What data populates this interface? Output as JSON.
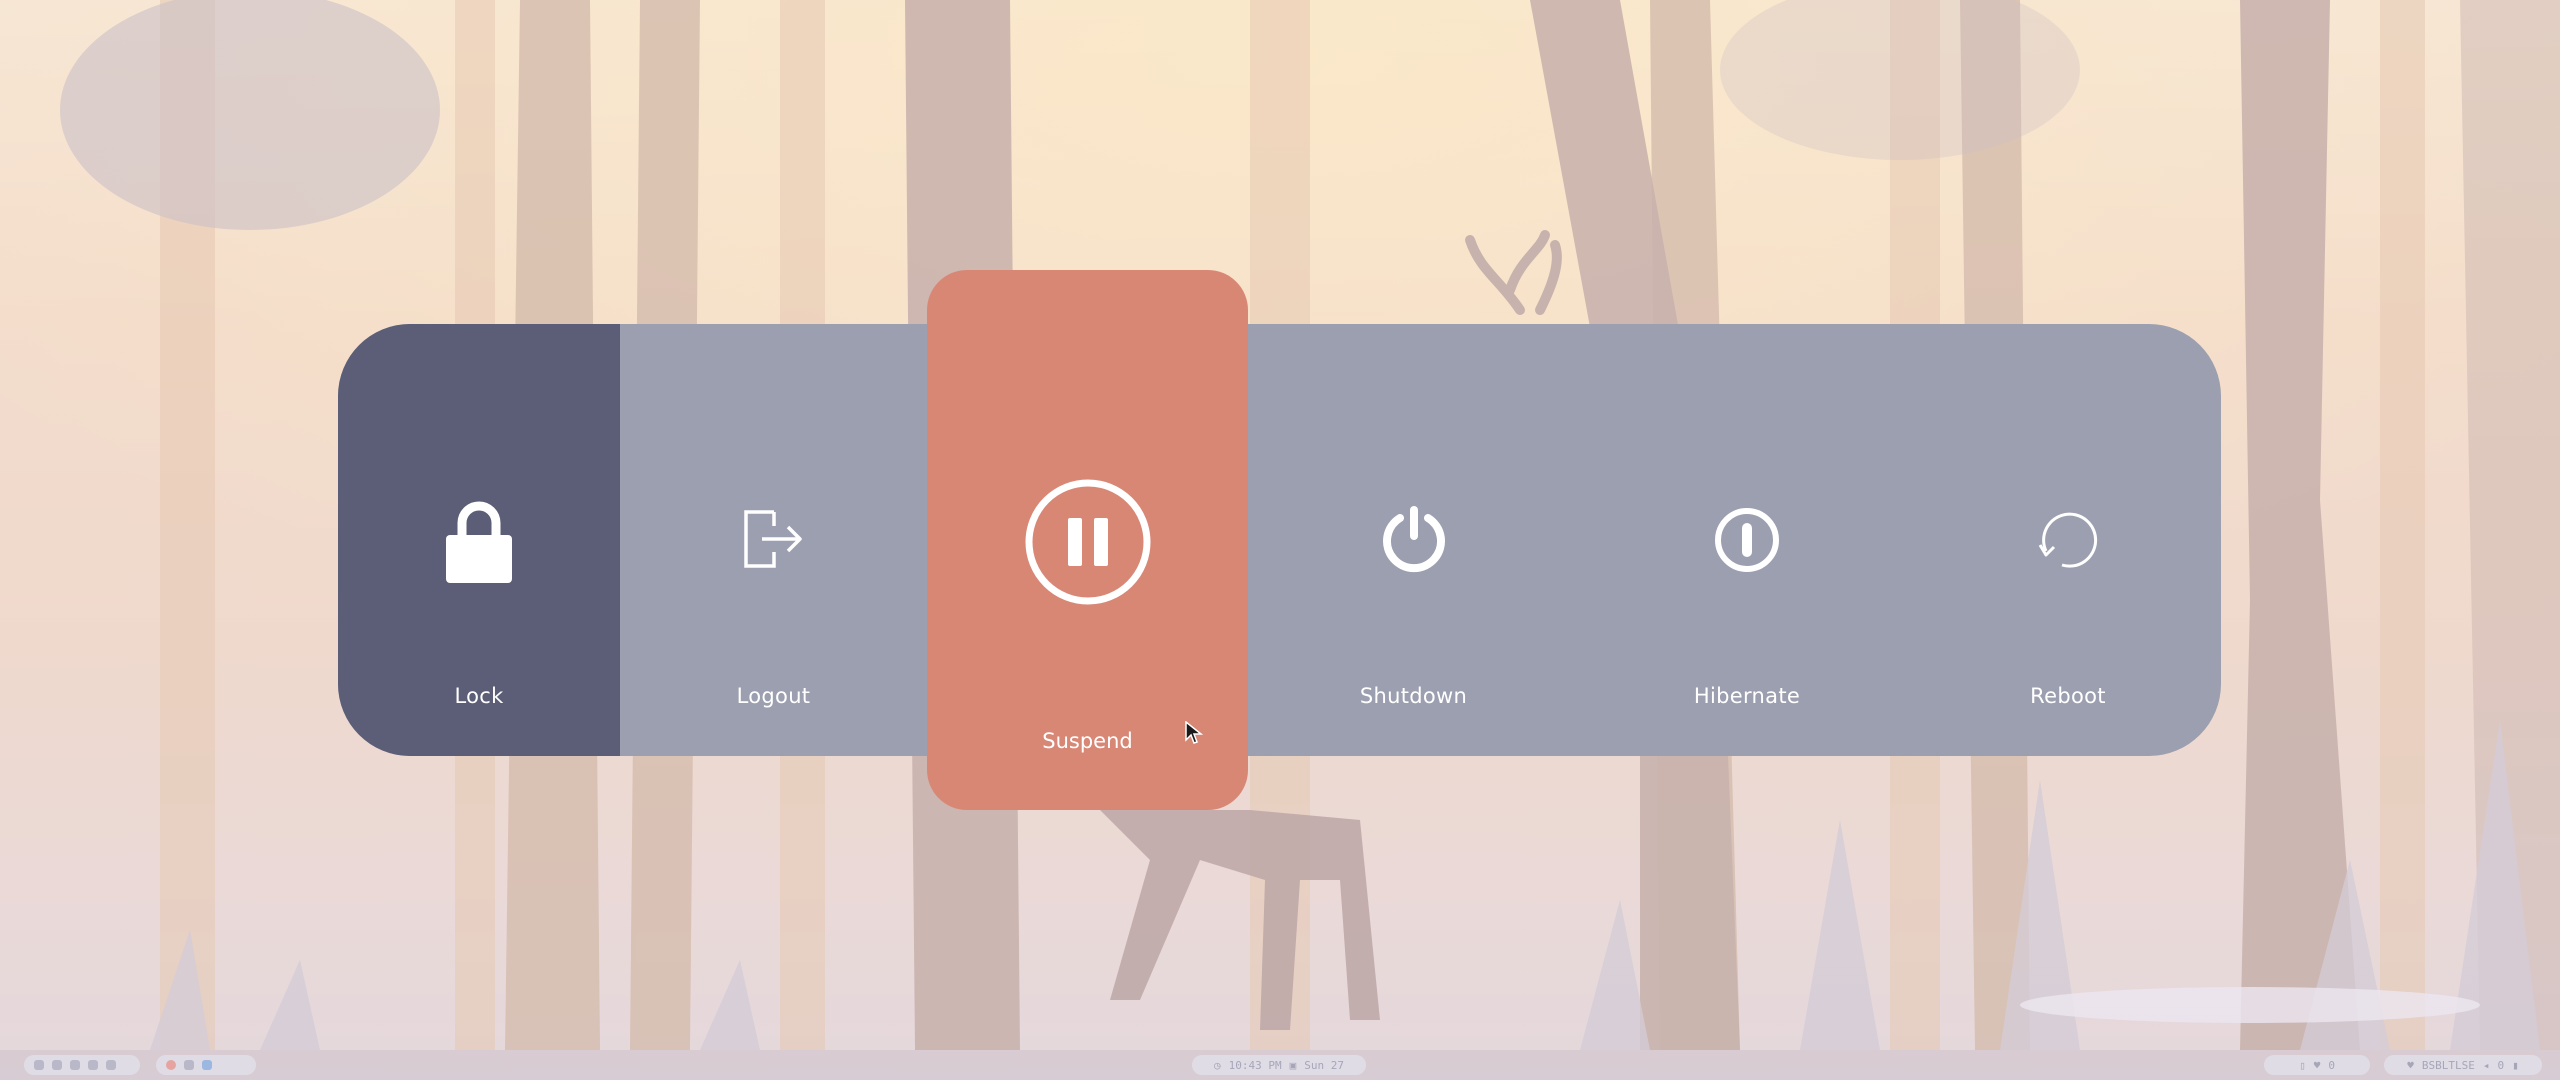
{
  "power_menu": {
    "buttons": [
      {
        "id": "lock",
        "label": "Lock",
        "icon": "lock-icon"
      },
      {
        "id": "logout",
        "label": "Logout",
        "icon": "logout-icon"
      },
      {
        "id": "suspend",
        "label": "Suspend",
        "icon": "pause-icon"
      },
      {
        "id": "shutdown",
        "label": "Shutdown",
        "icon": "power-icon"
      },
      {
        "id": "hibernate",
        "label": "Hibernate",
        "icon": "hibernate-icon"
      },
      {
        "id": "reboot",
        "label": "Reboot",
        "icon": "reboot-icon"
      }
    ],
    "selected": "suspend",
    "colors": {
      "panel": "#9c9fb0",
      "lock": "#5c5d76",
      "suspend": "#d98775",
      "text": "#ffffff"
    }
  },
  "taskbar": {
    "clock": "10:43 PM",
    "date": "Sun 27",
    "right_text": "BSBLTLSE",
    "right_count": "0"
  }
}
